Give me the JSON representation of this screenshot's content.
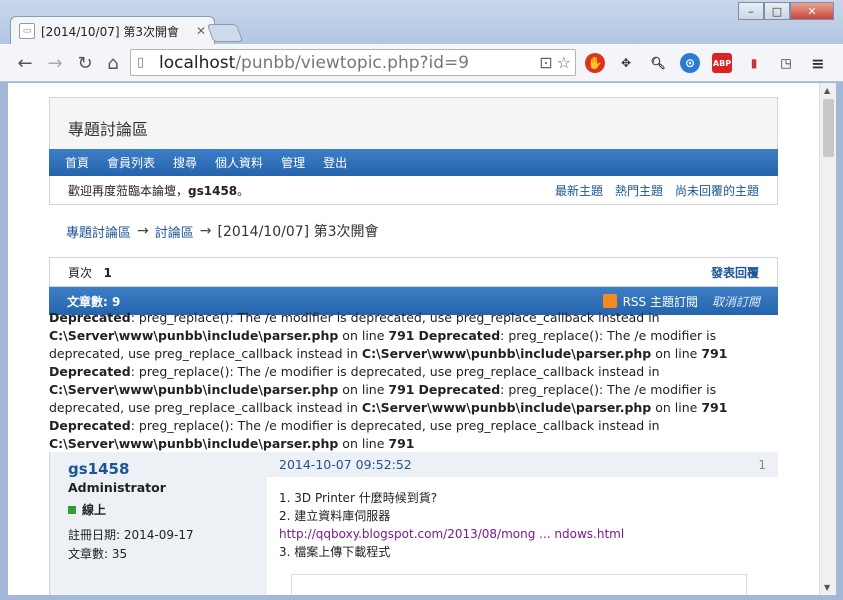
{
  "browser": {
    "tab_title": "[2014/10/07] 第3次開會",
    "url_host": "localhost",
    "url_path": "/punbb/viewtopic.php?id=9"
  },
  "forum": {
    "board_title": "專題討論區",
    "nav": [
      "首頁",
      "會員列表",
      "搜尋",
      "個人資料",
      "管理",
      "登出"
    ],
    "welcome_prefix": "歡迎再度蒞臨本論壇，",
    "welcome_user": "gs1458",
    "welcome_suffix": "。",
    "quick_links": [
      "最新主題",
      "熱門主題",
      "尚未回覆的主題"
    ],
    "crumb_index": "專題討論區",
    "crumb_forum": "討論區",
    "crumb_topic": "[2014/10/07] 第3次開會",
    "crumb_sep": "→",
    "pages_label": "頁次",
    "pages_value": "1",
    "post_reply": "發表回覆",
    "posts_count": "文章數: 9",
    "rss_label": "RSS 主題訂閱",
    "unsubscribe": "取消訂閱"
  },
  "warnings": {
    "label": "Deprecated",
    "message": ": preg_replace(): The /e modifier is deprecated, use preg_replace_callback instead in ",
    "file": "C:\\Server\\www\\punbb\\include\\parser.php",
    "on_line": " on line ",
    "line": "791"
  },
  "post": {
    "username": "gs1458",
    "user_title": "Administrator",
    "online": "線上",
    "registered": "註冊日期: 2014-09-17",
    "posts": "文章數: 35",
    "date": "2014-10-07 09:52:52",
    "number": "1",
    "line1": "1. 3D Printer 什麼時候到貨?",
    "line2": "2. 建立資料庫伺服器",
    "link": "http://qqboxy.blogspot.com/2013/08/mong ... ndows.html",
    "line3": "3. 檔案上傳下載程式"
  }
}
